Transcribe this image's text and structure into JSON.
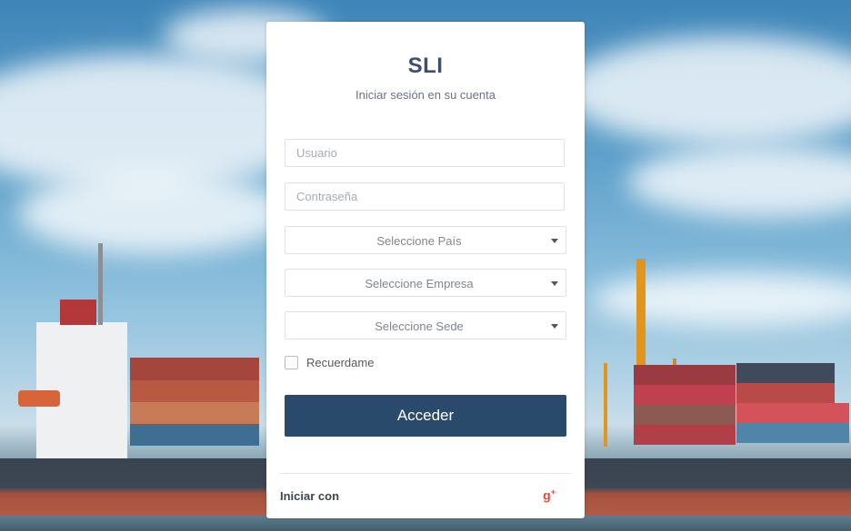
{
  "brand": "SLI",
  "subtitle": "Iniciar sesión en su cuenta",
  "form": {
    "username_placeholder": "Usuario",
    "password_placeholder": "Contraseña",
    "country_select": "Seleccione País",
    "company_select": "Seleccione Empresa",
    "site_select": "Seleccione Sede",
    "remember_label": "Recuerdame",
    "remember_checked": false,
    "submit_label": "Acceder"
  },
  "footer": {
    "login_with": "Iniciar con",
    "google_icon": "google-plus-icon"
  },
  "colors": {
    "primary_button": "#2a4a6b",
    "brand_text": "#3d4f6b",
    "google_red": "#dd4b39"
  }
}
